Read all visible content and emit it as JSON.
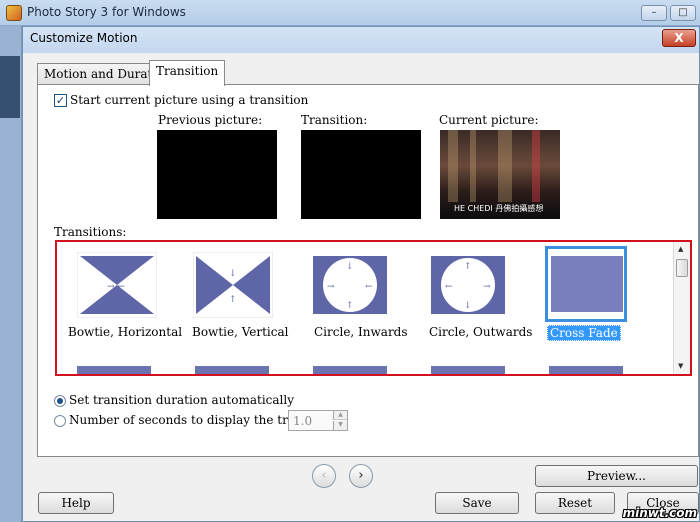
{
  "app": {
    "title": "Photo Story 3 for Windows",
    "min_glyph": "–",
    "max_glyph": "□"
  },
  "dialog": {
    "title": "Customize Motion",
    "close_glyph": "X"
  },
  "tabs": [
    {
      "label": "Motion and Duration",
      "active": false
    },
    {
      "label": "Transition",
      "active": true
    }
  ],
  "start_transition": {
    "checked": true,
    "check_glyph": "✓",
    "label": "Start current picture using a transition"
  },
  "preview": {
    "previous_label": "Previous picture:",
    "transition_label": "Transition:",
    "current_label": "Current picture:",
    "current_caption": "HE CHEDI 丹佛拍攝感想"
  },
  "transitions": {
    "label": "Transitions:",
    "items": [
      {
        "label": "Bowtie, Horizontal",
        "selected": false
      },
      {
        "label": "Bowtie, Vertical",
        "selected": false
      },
      {
        "label": "Circle, Inwards",
        "selected": false
      },
      {
        "label": "Circle, Outwards",
        "selected": false
      },
      {
        "label": "Cross Fade",
        "selected": true
      }
    ],
    "colors": {
      "shape": "#5f66a8",
      "selected_border": "#3c8ee0",
      "frame_border": "#d21020"
    }
  },
  "duration": {
    "auto_label": "Set transition duration automatically",
    "auto_checked": true,
    "manual_label": "Number of seconds to display the transition",
    "manual_checked": false,
    "seconds_value": "1.0"
  },
  "navigation": {
    "back_glyph": "‹",
    "forward_glyph": "›"
  },
  "buttons": {
    "preview": "Preview...",
    "help": "Help",
    "save": "Save",
    "reset": "Reset",
    "close": "Close"
  },
  "watermark": "minwt.com"
}
